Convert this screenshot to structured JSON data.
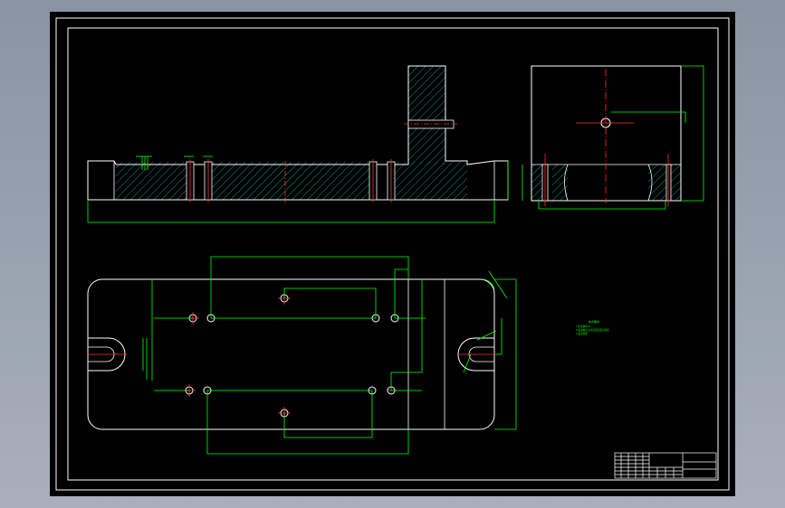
{
  "drawing": {
    "background": "#000000",
    "frame_color": "#ffffff",
    "dim_color": "#00ff00",
    "center_color": "#ff0000",
    "hatch_color": "#00c8c8",
    "outline_color": "#ffffff"
  },
  "notes": {
    "title": "技术要求",
    "lines": [
      "1.未注倒角C1",
      "2.锐边倒钝,去毛刺及表面氧化皮",
      "3.发蓝处理"
    ]
  },
  "title_block": {
    "cells": [
      "",
      "",
      "",
      "",
      ""
    ]
  }
}
